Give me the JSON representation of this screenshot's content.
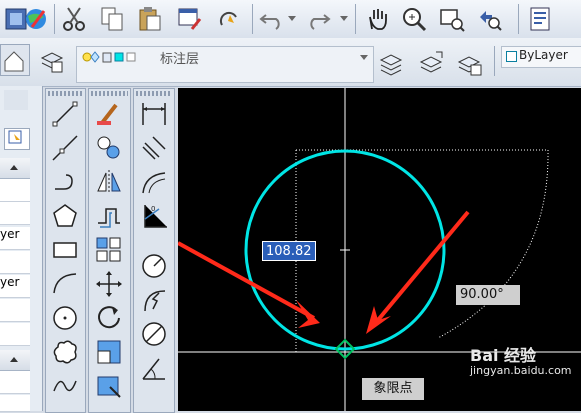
{
  "toolbar": {
    "icons": [
      "layer-icon",
      "globe-icon",
      "cut-icon",
      "copy-icon",
      "paste-icon",
      "match-properties-icon",
      "quick-select-icon",
      "undo-icon",
      "redo-icon",
      "pan-hand-icon",
      "zoom-realtime-icon",
      "zoom-window-icon",
      "zoom-previous-icon",
      "properties-icon"
    ]
  },
  "layer_bar": {
    "current_layer": "标注层",
    "color_label": "ByLayer",
    "color_swatch": "#ffffff"
  },
  "left_panel": {
    "rows": [
      "",
      "",
      "yer",
      "",
      "yer",
      "",
      "",
      ""
    ]
  },
  "canvas": {
    "dimension_value": "108.82",
    "angle_value": "90.00°",
    "snap_tooltip": "象限点",
    "circle_color": "#00e5e5",
    "arrow_color": "#ff2a1a",
    "snap_marker_color": "#00c060"
  },
  "watermark": {
    "text": "Bai 经验",
    "url": "jingyan.baidu.com"
  }
}
